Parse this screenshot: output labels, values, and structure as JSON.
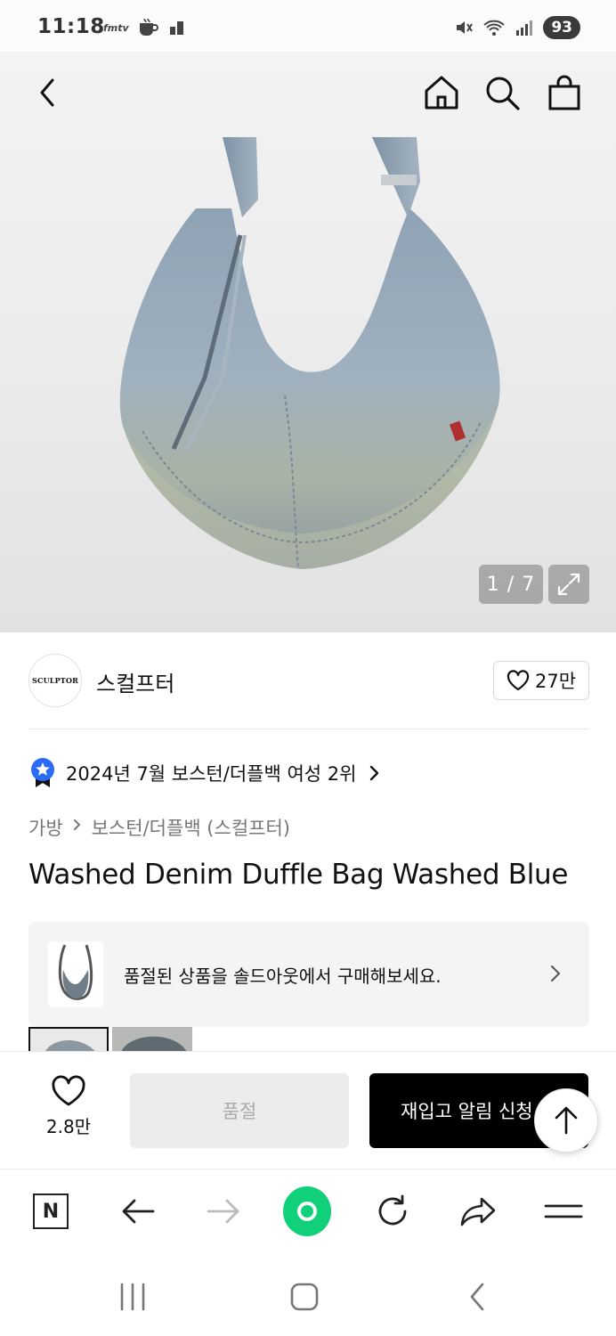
{
  "status_bar": {
    "time": "11:18",
    "mini_label": "fmtv",
    "battery": "93"
  },
  "gallery": {
    "counter": "1 / 7"
  },
  "brand": {
    "logo_text": "SCULPTOR",
    "name": "스컬프터",
    "likes": "27만"
  },
  "ranking": {
    "text": "2024년 7월 보스턴/더플백 여성 2위"
  },
  "breadcrumb": {
    "items": [
      "가방",
      "보스턴/더플백 (스컬프터)"
    ]
  },
  "product": {
    "title": "Washed Denim Duffle Bag Washed Blue"
  },
  "soldout_banner": {
    "text": "품절된 상품을 솔드아웃에서 구매해보세요."
  },
  "buy_bar": {
    "wish_count": "2.8만",
    "soldout_label": "품절",
    "restock_label": "재입고 알림 신청"
  },
  "icons": {
    "back": "chevron-left-icon",
    "home": "home-icon",
    "search": "search-icon",
    "cart": "shopping-bag-icon",
    "expand": "expand-icon",
    "like": "heart-icon",
    "top": "arrow-up-icon"
  }
}
